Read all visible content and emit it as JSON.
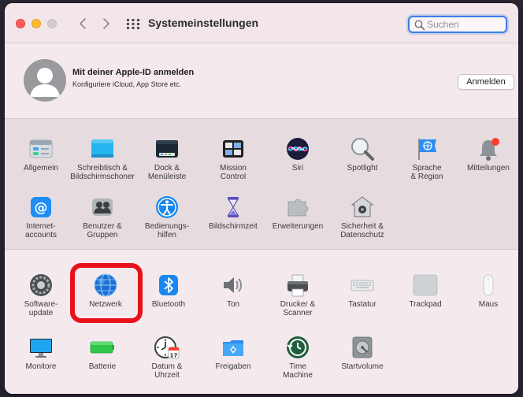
{
  "window": {
    "title": "Systemeinstellungen"
  },
  "search": {
    "placeholder": "Suchen"
  },
  "apple_id": {
    "title": "Mit deiner Apple-ID anmelden",
    "subtitle": "Konfiguriere iCloud, App Store etc.",
    "button": "Anmelden"
  },
  "panes_row1": [
    {
      "label": "Allgemein",
      "icon": "general-icon"
    },
    {
      "label": "Schreibtisch &\nBildschirmschoner",
      "icon": "desktop-screensaver-icon"
    },
    {
      "label": "Dock &\nMenüleiste",
      "icon": "dock-icon"
    },
    {
      "label": "Mission\nControl",
      "icon": "mission-control-icon"
    },
    {
      "label": "Siri",
      "icon": "siri-icon"
    },
    {
      "label": "Spotlight",
      "icon": "spotlight-icon"
    },
    {
      "label": "Sprache\n& Region",
      "icon": "language-region-icon"
    },
    {
      "label": "Mitteilungen",
      "icon": "notifications-icon"
    }
  ],
  "panes_row2": [
    {
      "label": "Internet-\naccounts",
      "icon": "internet-accounts-icon"
    },
    {
      "label": "Benutzer &\nGruppen",
      "icon": "users-groups-icon"
    },
    {
      "label": "Bedienungs-\nhilfen",
      "icon": "accessibility-icon"
    },
    {
      "label": "Bildschirmzeit",
      "icon": "screen-time-icon"
    },
    {
      "label": "Erweiterungen",
      "icon": "extensions-icon"
    },
    {
      "label": "Sicherheit &\nDatenschutz",
      "icon": "security-privacy-icon"
    }
  ],
  "panes_row3": [
    {
      "label": "Software-\nupdate",
      "icon": "software-update-icon"
    },
    {
      "label": "Netzwerk",
      "icon": "network-icon"
    },
    {
      "label": "Bluetooth",
      "icon": "bluetooth-icon"
    },
    {
      "label": "Ton",
      "icon": "sound-icon"
    },
    {
      "label": "Drucker &\nScanner",
      "icon": "printer-scanner-icon"
    },
    {
      "label": "Tastatur",
      "icon": "keyboard-icon"
    },
    {
      "label": "Trackpad",
      "icon": "trackpad-icon"
    },
    {
      "label": "Maus",
      "icon": "mouse-icon"
    }
  ],
  "panes_row4": [
    {
      "label": "Monitore",
      "icon": "displays-icon"
    },
    {
      "label": "Batterie",
      "icon": "battery-icon"
    },
    {
      "label": "Datum &\nUhrzeit",
      "icon": "date-time-icon"
    },
    {
      "label": "Freigaben",
      "icon": "sharing-icon"
    },
    {
      "label": "Time\nMachine",
      "icon": "time-machine-icon"
    },
    {
      "label": "Startvolume",
      "icon": "startup-disk-icon"
    }
  ],
  "calendar_icon_day": "17",
  "highlighted_pane": "Netzwerk",
  "colors": {
    "highlight": "#e8101a",
    "search_focus": "#3d7fe6"
  }
}
